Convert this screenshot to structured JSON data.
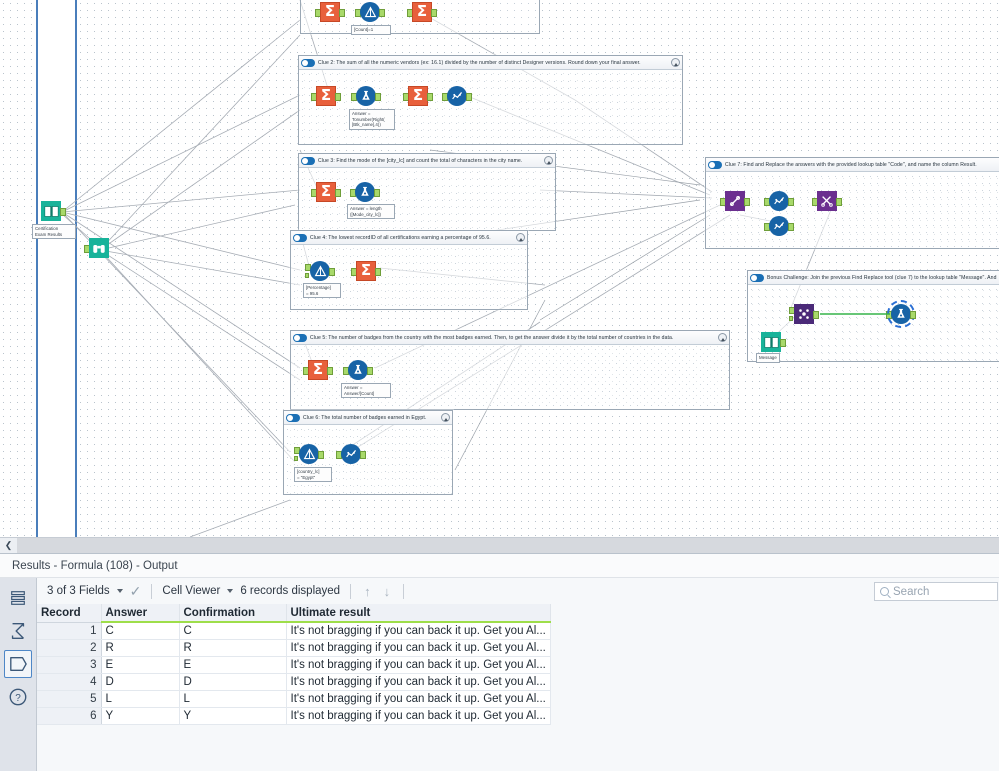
{
  "canvas": {
    "input_tool": {
      "label": "Certification\nExam Results",
      "icon": "input-data-icon"
    },
    "browse_tool": {
      "icon": "browse-binoculars-icon"
    },
    "containers": [
      {
        "id": "c1",
        "title": "",
        "annotation": "[Count]=1",
        "collapse_icon": "collapse-icon",
        "toggle_icon": "container-toggle-icon"
      },
      {
        "id": "c2",
        "title": "Clue 2: The sum of all the numeric vendors (ex: 16.1) divided by the number of distinct Designer versions. Round down your final answer.",
        "annotation": "Answer =\nTonumber(Right(\n[Btk_name],4))",
        "collapse_icon": "collapse-icon",
        "toggle_icon": "container-toggle-icon"
      },
      {
        "id": "c3",
        "title": "Clue 3: Find the mode of the [city_lc] and count the total of characters in the city name.",
        "annotation": "Answer = length\n([Mode_city_lc])",
        "collapse_icon": "collapse-icon",
        "toggle_icon": "container-toggle-icon"
      },
      {
        "id": "c4",
        "title": "Clue 4: The lowest recordID of all certifications earning a percentage of 95.6.",
        "annotation": "[Percentage]\n= 95.6",
        "collapse_icon": "collapse-icon",
        "toggle_icon": "container-toggle-icon"
      },
      {
        "id": "c5",
        "title": "Clue 5: The number of badges from the country with the most badges earned. Then, to get the answer divide it by the total number of countries in the data.",
        "annotation": "Answer =\nAnswer/[Count]",
        "collapse_icon": "collapse-icon",
        "toggle_icon": "container-toggle-icon"
      },
      {
        "id": "c6",
        "title": "Clue 6: The total number of badges earned in Egypt.",
        "annotation": "[country_lc]\n= \"Egypt\"",
        "collapse_icon": "collapse-icon",
        "toggle_icon": "container-toggle-icon"
      },
      {
        "id": "c7",
        "title": "Clue 7: Find and Replace the answers with the provided lookup table \"Code\", and name the column Result.",
        "collapse_icon": "collapse-icon",
        "toggle_icon": "container-toggle-icon"
      },
      {
        "id": "c8",
        "title": "Bonus Challenge: Join the previous Find Replace tool (clue 7) to the lookup table \"Message\". And",
        "lookup_label": "Message",
        "collapse_icon": "collapse-icon",
        "toggle_icon": "container-toggle-icon"
      }
    ],
    "scrollbar": {
      "left_button_icon": "chevron-left-icon"
    }
  },
  "results": {
    "title": "Results - Formula (108) - Output",
    "sidebar": [
      {
        "icon": "table-view-icon",
        "active": false
      },
      {
        "icon": "summary-sigma-icon",
        "active": false
      },
      {
        "icon": "data-shape-icon",
        "active": true
      },
      {
        "icon": "help-question-icon",
        "active": false
      }
    ],
    "toolbar": {
      "fields_label": "3 of 3 Fields",
      "check_icon": "checkmark-icon",
      "cell_viewer_label": "Cell Viewer",
      "records_label": "6 records displayed",
      "up_arrow_icon": "arrow-up-icon",
      "down_arrow_icon": "arrow-down-icon"
    },
    "search": {
      "placeholder": "Search",
      "value": "",
      "icon": "search-icon"
    },
    "table": {
      "columns": [
        "Record",
        "Answer",
        "Confirmation",
        "Ultimate result"
      ],
      "rows": [
        {
          "record": "1",
          "answer": "C",
          "confirmation": "C",
          "ultimate": "It's not bragging if you can back it up. Get you Al..."
        },
        {
          "record": "2",
          "answer": "R",
          "confirmation": "R",
          "ultimate": "It's not bragging if you can back it up. Get you Al..."
        },
        {
          "record": "3",
          "answer": "E",
          "confirmation": "E",
          "ultimate": "It's not bragging if you can back it up. Get you Al..."
        },
        {
          "record": "4",
          "answer": "D",
          "confirmation": "D",
          "ultimate": "It's not bragging if you can back it up. Get you Al..."
        },
        {
          "record": "5",
          "answer": "L",
          "confirmation": "L",
          "ultimate": "It's not bragging if you can back it up. Get you Al..."
        },
        {
          "record": "6",
          "answer": "Y",
          "confirmation": "Y",
          "ultimate": "It's not bragging if you can back it up. Get you Al..."
        }
      ]
    }
  },
  "colors": {
    "summarize": "#e8603c",
    "formula": "#1763a6",
    "browse": "#1763a6",
    "select": "#6b2f8f",
    "join": "#4b2a78",
    "input": "#18b39a",
    "accent_green": "#9ede4a",
    "container_border": "#9aa7b4"
  }
}
